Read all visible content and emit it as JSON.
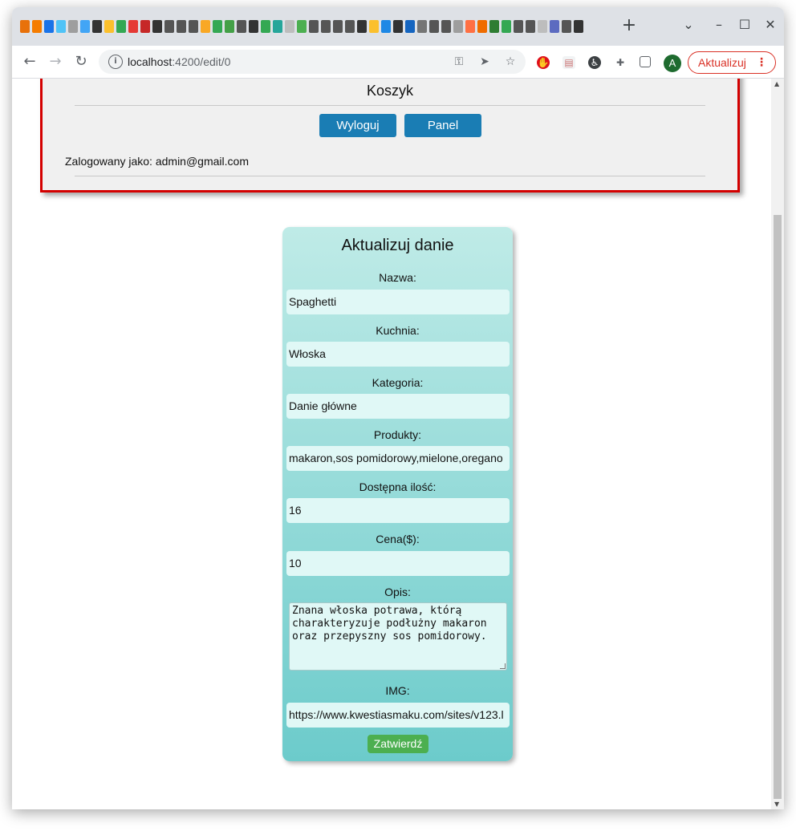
{
  "browser": {
    "new_tab": "+",
    "url_host": "localhost",
    "url_path": ":4200/edit/0",
    "avatar_letter": "A",
    "update_label": "Aktualizuj",
    "update_menu": "⋮"
  },
  "header": {
    "cart_label": "Koszyk",
    "logout_label": "Wyloguj",
    "panel_label": "Panel",
    "logged_in_text": "Zalogowany jako: admin@gmail.com"
  },
  "form": {
    "title": "Aktualizuj danie",
    "fields": [
      {
        "label": "Nazwa:",
        "value": "Spaghetti"
      },
      {
        "label": "Kuchnia:",
        "value": "Włoska"
      },
      {
        "label": "Kategoria:",
        "value": "Danie główne"
      },
      {
        "label": "Produkty:",
        "value": "makaron,sos pomidorowy,mielone,oregano"
      },
      {
        "label": "Dostępna ilość:",
        "value": "16"
      },
      {
        "label": "Cena($):",
        "value": "10"
      }
    ],
    "description": {
      "label": "Opis:",
      "value": "Znana włoska potrawa, którą charakteryzuje podłużny makaron oraz przepyszny sos pomidorowy."
    },
    "image": {
      "label": "IMG:",
      "value": "https://www.kwestiasmaku.com/sites/v123.l"
    },
    "submit_label": "Zatwierdź"
  },
  "colors": {
    "header_border": "#d40000",
    "button_blue": "#1a7db4",
    "submit_green": "#4caf50",
    "card_top": "#bfebe7",
    "card_bottom": "#6ccbcb"
  }
}
